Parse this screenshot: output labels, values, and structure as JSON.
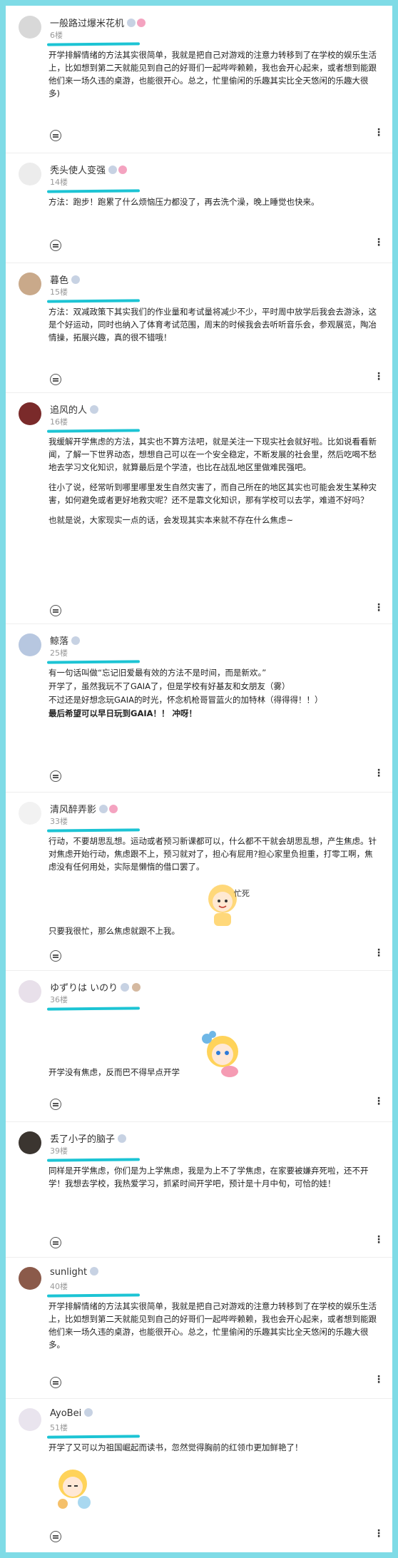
{
  "posts": [
    {
      "name": "一般路过爆米花机",
      "floor": "6楼",
      "text": [
        "开学排解情绪的方法其实很简单，我就是把自己对游戏的注意力转移到了在学校的娱乐生活上，比如想到第二天就能见到自己的好哥们一起哔哔赖赖，我也会开心起来，或者想到能跟他们来一场久违的桌游，也能很开心。总之，忙里偷闲的乐趣其实比全天悠闲的乐趣大很多)"
      ]
    },
    {
      "name": "秃头使人变强",
      "floor": "14楼",
      "text": [
        "方法：跑步！跑累了什么烦恼压力都没了，再去洗个澡，晚上睡觉也快来。"
      ]
    },
    {
      "name": "暮色",
      "floor": "15楼",
      "text": [
        "方法：双减政策下其实我们的作业量和考试量将减少不少，平时周中放学后我会去游泳，这是个好运动，同时也纳入了体育考试范围，周末的时候我会去听听音乐会，参观展览，陶冶情操，拓展兴趣，真的很不错哦！"
      ]
    },
    {
      "name": "追风的人",
      "floor": "16楼",
      "text": [
        "我缓解开学焦虑的方法，其实也不算方法吧，就是关注一下现实社会就好啦。比如说看看新闻，了解一下世界动态，想想自己可以在一个安全稳定，不断发展的社会里，然后吃喝不愁地去学习文化知识，就算最后是个学渣，也比在战乱地区里做难民强吧。",
        "往小了说，经常听到哪里哪里发生自然灾害了，而自己所在的地区其实也可能会发生某种灾害，如何避免或者更好地救灾呢？还不是靠文化知识，那有学校可以去学，难道不好吗？",
        "也就是说，大家现实一点的话，会发现其实本来就不存在什么焦虑~"
      ]
    },
    {
      "name": "鲸落",
      "floor": "25楼",
      "text": [
        "有一句话叫做“忘记旧爱最有效的方法不是时间，而是新欢。”",
        "开学了，虽然我玩不了GAIA了，但是学校有好基友和女朋友（雾）",
        "不过还是好想念玩GAIA的时光，怀念机枪哥冒蓝火的加特林（得得得！！）"
      ],
      "bold": "最后希望可以早日玩到GAIA！！ 冲呀！"
    },
    {
      "name": "清风醉弄影",
      "floor": "33楼",
      "text": [
        "行动，不要胡思乱想。运动或者预习新课都可以，什么都不干就会胡思乱想，产生焦虑。针对焦虑开始行动，焦虑跟不上，预习就对了，担心有屁用?担心家里负担重，打零工啊，焦虑没有任何用处，实际是懒惰的借口罢了。"
      ],
      "text2": "只要我很忙，那么焦虑就跟不上我。"
    },
    {
      "name": "ゆずりは いのり",
      "floor": "36楼",
      "text": [
        "开学没有焦虑，反而巴不得早点开学"
      ]
    },
    {
      "name": "丢了小子的脑子",
      "floor": "39楼",
      "text": [
        "同样是开学焦虑，你们是为上学焦虑，我是为上不了学焦虑，在家要被嫌弃死啦，还不开学！我想去学校，我热爱学习，抓紧时间开学吧，预计是十月中旬，可恰的娃！"
      ]
    },
    {
      "name": "sunlight",
      "floor": "40楼",
      "text": [
        "开学排解情绪的方法其实很简单，我就是把自己对游戏的注意力转移到了在学校的娱乐生活上，比如想到第二天就能见到自己的好哥们一起哔哔赖赖，我也会开心起来，或者想到能跟他们来一场久违的桌游，也能很开心。总之，忙里偷闲的乐趣其实比全天悠闲的乐趣大很多。"
      ]
    },
    {
      "name": "AyoBei",
      "floor": "51楼",
      "text": [
        "开学了又可以为祖国崛起而读书，忽然觉得胸前的红领巾更加鲜艳了！"
      ]
    }
  ],
  "sticker_text": "忙死"
}
